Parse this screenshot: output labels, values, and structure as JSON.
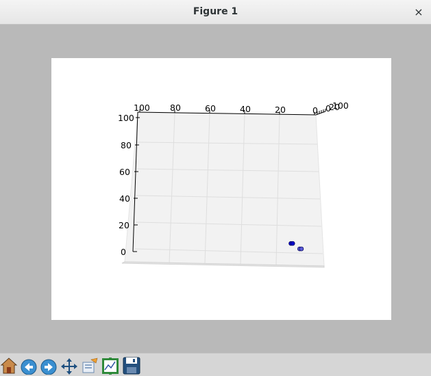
{
  "window": {
    "title": "Figure 1",
    "close_glyph": "×"
  },
  "toolbar": {
    "buttons": [
      {
        "icon": "home-icon",
        "tooltip": "Reset original view"
      },
      {
        "icon": "back-arrow-icon",
        "tooltip": "Back to previous view"
      },
      {
        "icon": "forward-arrow-icon",
        "tooltip": "Forward to next view"
      },
      {
        "icon": "pan-move-icon",
        "tooltip": "Pan axes"
      },
      {
        "icon": "zoom-rect-icon",
        "tooltip": "Zoom to rectangle"
      },
      {
        "icon": "configure-subplots-icon",
        "tooltip": "Configure subplots"
      },
      {
        "icon": "save-figure-icon",
        "tooltip": "Save the figure"
      }
    ]
  },
  "chart_data": {
    "type": "scatter",
    "projection": "3d",
    "x_tick_labels": [
      "100",
      "80",
      "60",
      "40",
      "20",
      "0"
    ],
    "y_tick_labels": [
      "0",
      "20",
      "40",
      "60",
      "80",
      "100"
    ],
    "z_tick_labels_partial": [
      "0",
      "20",
      "100"
    ],
    "xlim": [
      0,
      100
    ],
    "ylim": [
      0,
      100
    ],
    "zlim": [
      0,
      100
    ],
    "grid": true,
    "series": [
      {
        "color": "#0000cc",
        "points": [
          {
            "x": 8,
            "y": 2,
            "z": 0
          },
          {
            "x": 7,
            "y": 2,
            "z": 0
          },
          {
            "x": 3,
            "y": 1,
            "z": 0
          },
          {
            "x": 2,
            "y": 1,
            "z": 0
          }
        ]
      }
    ]
  }
}
